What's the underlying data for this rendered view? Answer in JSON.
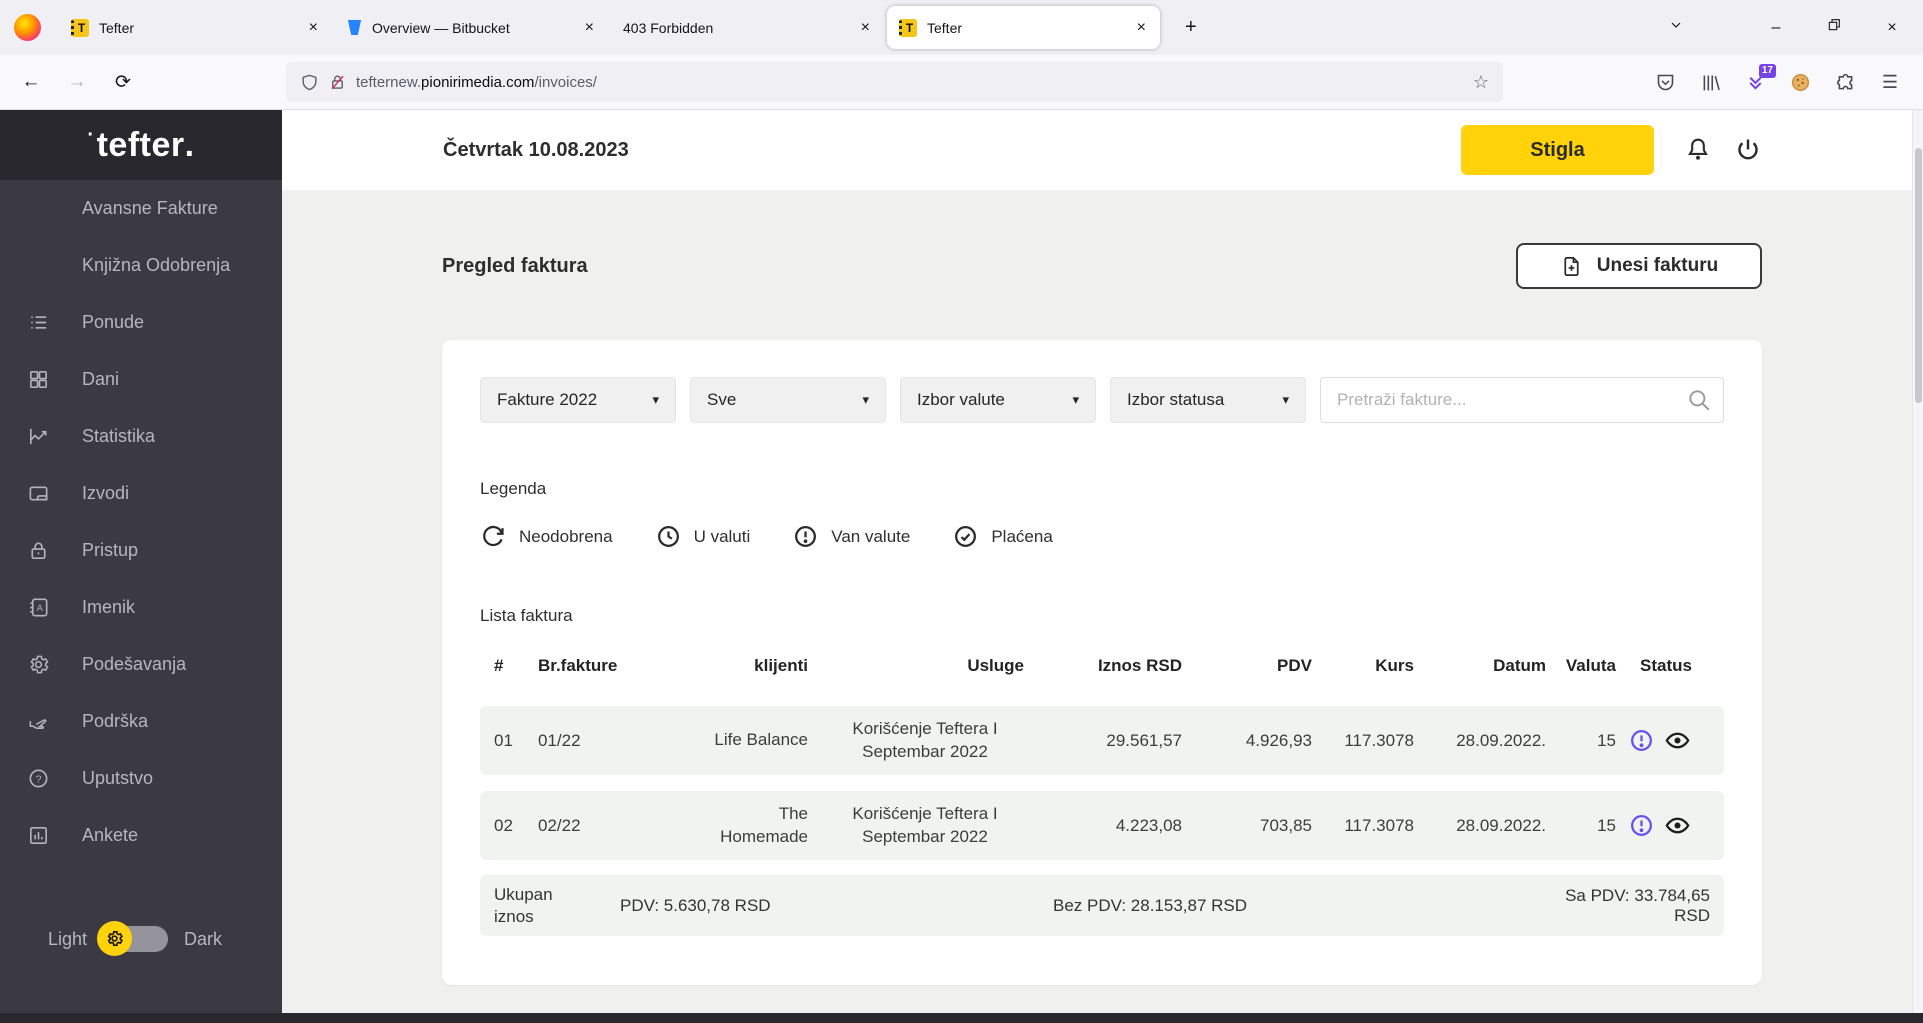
{
  "icons": {
    "close": "×",
    "new_tab": "+",
    "back": "←",
    "forward": "→",
    "reload": "⟳",
    "star": "☆",
    "menu": "☰",
    "minimize": "–",
    "caret": "▾"
  },
  "browser": {
    "tabs": [
      {
        "title": "Tefter"
      },
      {
        "title": "Overview — Bitbucket"
      },
      {
        "title": "403 Forbidden"
      },
      {
        "title": "Tefter"
      }
    ],
    "url": {
      "prefix": "tefternew.",
      "domain": "pionirimedia.com",
      "path": "/invoices/"
    },
    "downloads_badge": "17"
  },
  "sidebar": {
    "logo": {
      "dot": "·",
      "name": "tefter",
      "period": "."
    },
    "items": [
      {
        "label": "Avansne Fakture"
      },
      {
        "label": "Knjižna Odobrenja"
      },
      {
        "label": "Ponude"
      },
      {
        "label": "Dani"
      },
      {
        "label": "Statistika"
      },
      {
        "label": "Izvodi"
      },
      {
        "label": "Pristup"
      },
      {
        "label": "Imenik"
      },
      {
        "label": "Podešavanja"
      },
      {
        "label": "Podrška"
      },
      {
        "label": "Uputstvo"
      },
      {
        "label": "Ankete"
      }
    ],
    "theme": {
      "light": "Light",
      "dark": "Dark"
    }
  },
  "header": {
    "date": "Četvrtak 10.08.2023",
    "status_button": "Stigla"
  },
  "main": {
    "title": "Pregled faktura",
    "add_invoice_button": "Unesi fakturu",
    "filters": {
      "year": "Fakture 2022",
      "client": "Sve",
      "currency": "Izbor valute",
      "status": "Izbor statusa",
      "search_placeholder": "Pretraži fakture..."
    },
    "legend": {
      "title": "Legenda",
      "items": [
        {
          "label": "Neodobrena"
        },
        {
          "label": "U valuti"
        },
        {
          "label": "Van valute"
        },
        {
          "label": "Plaćena"
        }
      ]
    },
    "list": {
      "title": "Lista faktura",
      "columns": [
        "#",
        "Br.fakture",
        "klijenti",
        "Usluge",
        "Iznos RSD",
        "PDV",
        "Kurs",
        "Datum",
        "Valuta",
        "Status"
      ],
      "rows": [
        {
          "num": "01",
          "br": "01/22",
          "klijent": "Life Balance",
          "usluga": "Korišćenje Teftera I Septembar 2022",
          "iznos": "29.561,57",
          "pdv": "4.926,93",
          "kurs": "117.3078",
          "datum": "28.09.2022.",
          "valuta": "15"
        },
        {
          "num": "02",
          "br": "02/22",
          "klijent": "The Homemade",
          "usluga": "Korišćenje Teftera I Septembar 2022",
          "iznos": "4.223,08",
          "pdv": "703,85",
          "kurs": "117.3078",
          "datum": "28.09.2022.",
          "valuta": "15"
        }
      ],
      "totals": {
        "label": "Ukupan iznos",
        "pdv": "PDV: 5.630,78 RSD",
        "bez_pdv": "Bez PDV: 28.153,87 RSD",
        "sa_pdv": "Sa PDV: 33.784,65 RSD"
      }
    }
  },
  "colors": {
    "accent_yellow": "#ffd20a",
    "status_purple": "#6a4ff0"
  }
}
